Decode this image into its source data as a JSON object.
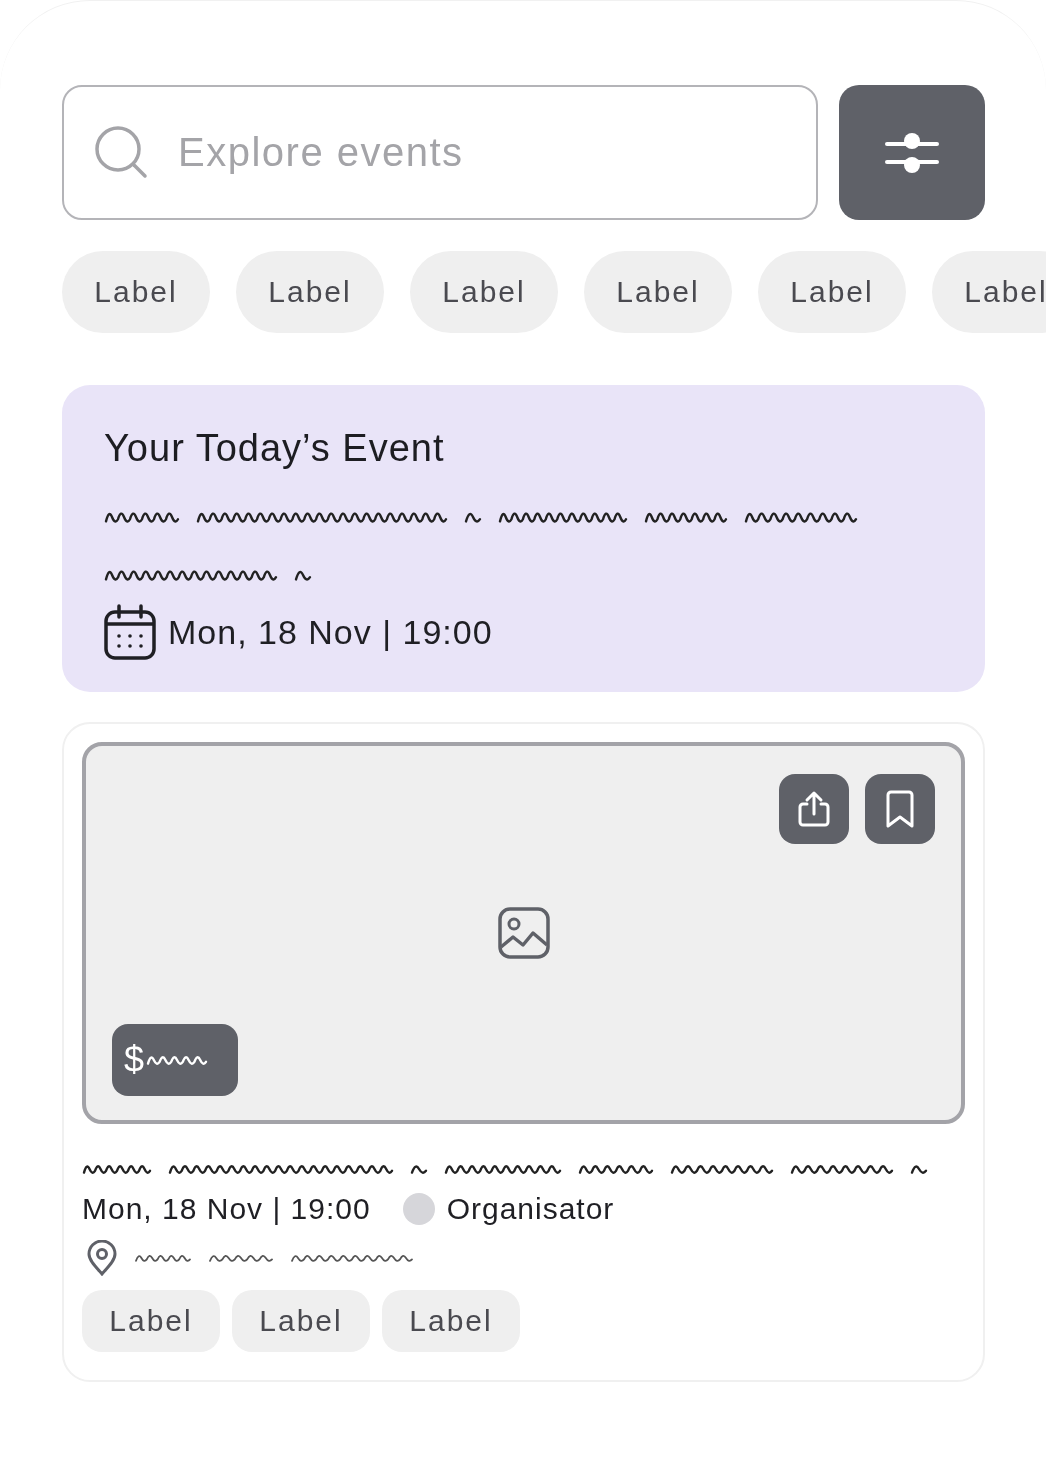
{
  "search": {
    "placeholder": "Explore events"
  },
  "filters": [
    {
      "label": "Label"
    },
    {
      "label": "Label"
    },
    {
      "label": "Label"
    },
    {
      "label": "Label"
    },
    {
      "label": "Label"
    },
    {
      "label": "Label"
    }
  ],
  "today_event": {
    "title": "Your Today’s Event",
    "date": "Mon, 18 Nov | 19:00"
  },
  "event_card": {
    "price": "$",
    "date": "Mon, 18 Nov | 19:00",
    "organiser": "Organisator",
    "tags": [
      {
        "label": "Label"
      },
      {
        "label": "Label"
      },
      {
        "label": "Label"
      }
    ]
  }
}
